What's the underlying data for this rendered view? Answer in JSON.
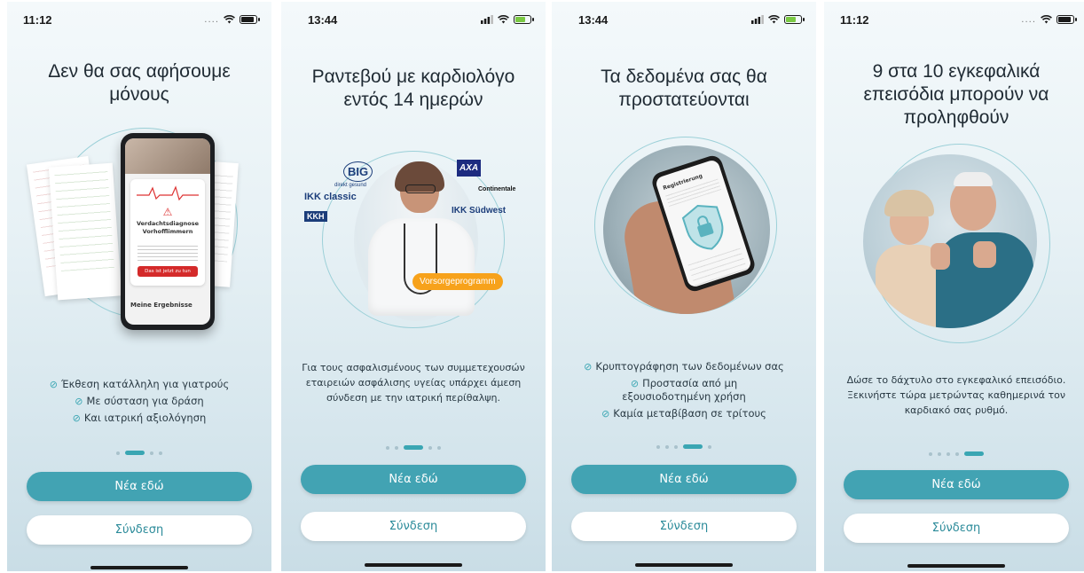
{
  "colors": {
    "accent": "#42a3b3",
    "button_text_secondary": "#2a8a99",
    "badge": "#f7a21b"
  },
  "screens": [
    {
      "status": {
        "time": "11:12",
        "signal": "....",
        "icons": [
          "wifi-icon",
          "battery-icon"
        ]
      },
      "title": "Δεν θα σας αφήσουμε μόνους",
      "hero": {
        "image": "phone-with-ecg-reports",
        "phone_dialog_title": "Verdachtsdiagnose Vorhofflimmern",
        "phone_button": "Das ist jetzt zu tun",
        "phone_footer": "Meine Ergebnisse"
      },
      "features": [
        "Έκθεση κατάλληλη για γιατρούς",
        "Με σύσταση για δράση",
        "Και ιατρική αξιολόγηση"
      ],
      "pager": {
        "count": 4,
        "active": 1
      },
      "primary_button": "Νέα εδώ",
      "secondary_button": "Σύνδεση"
    },
    {
      "status": {
        "time": "13:44",
        "icons": [
          "signal-icon",
          "wifi-icon",
          "battery-charging-icon"
        ]
      },
      "title": "Ραντεβού με καρδιολόγο εντός 14 ημερών",
      "hero": {
        "image": "doctor-with-insurer-logos",
        "badge": "Vorsorgeprogramm",
        "logos": [
          "BIG",
          "direkt gesund",
          "IKK classic",
          "KKH",
          "AXA",
          "Continentale",
          "IKK Südwest"
        ]
      },
      "body": "Για τους ασφαλισμένους των συμμετεχουσών εταιρειών ασφάλισης υγείας υπάρχει άμεση σύνδεση με την ιατρική περίθαλψη.",
      "pager": {
        "count": 5,
        "active": 2
      },
      "primary_button": "Νέα εδώ",
      "secondary_button": "Σύνδεση"
    },
    {
      "status": {
        "time": "13:44",
        "icons": [
          "signal-icon",
          "wifi-icon",
          "battery-charging-icon"
        ]
      },
      "title": "Τα δεδομένα σας θα προστατεύονται",
      "hero": {
        "image": "hand-holding-phone-with-shield",
        "phone_header": "Registrierung"
      },
      "features": [
        "Κρυπτογράφηση των δεδομένων σας",
        "Προστασία από μη εξουσιοδοτημένη χρήση",
        "Καμία μεταβίβαση σε τρίτους"
      ],
      "pager": {
        "count": 5,
        "active": 3
      },
      "primary_button": "Νέα εδώ",
      "secondary_button": "Σύνδεση"
    },
    {
      "status": {
        "time": "11:12",
        "signal": "....",
        "icons": [
          "wifi-icon",
          "battery-icon"
        ]
      },
      "title": "9 στα 10 εγκεφαλικά επεισόδια μπορούν να προληφθούν",
      "hero": {
        "image": "senior-couple-thumbs-up"
      },
      "body": "Δώσε το δάχτυλο στο εγκεφαλικό επεισόδιο. Ξεκινήστε τώρα μετρώντας καθημερινά τον καρδιακό σας ρυθμό.",
      "pager": {
        "count": 5,
        "active": 4
      },
      "primary_button": "Νέα εδώ",
      "secondary_button": "Σύνδεση"
    }
  ]
}
